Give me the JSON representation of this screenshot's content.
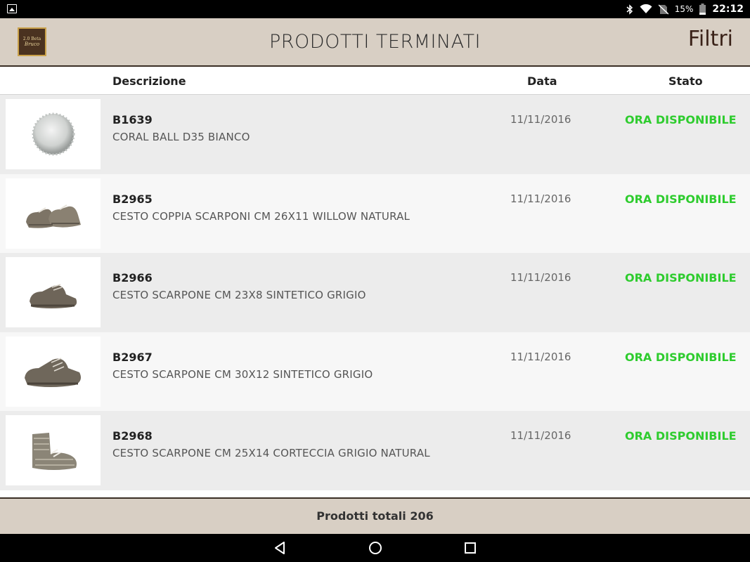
{
  "status_bar": {
    "battery": "15%",
    "time": "22:12",
    "icons": [
      "image-icon",
      "bluetooth-icon",
      "wifi-icon",
      "no-sim-icon",
      "battery-icon"
    ]
  },
  "header": {
    "title": "PRODOTTI TERMINATI",
    "filters_label": "Filtri",
    "logo_line1": "2.0 Beta",
    "logo_line2": "Bruco"
  },
  "columns": {
    "description": "Descrizione",
    "date": "Data",
    "status": "Stato"
  },
  "products": [
    {
      "code": "B1639",
      "description": "CORAL BALL D35 BIANCO",
      "date": "11/11/2016",
      "status": "ORA DISPONIBILE",
      "thumb": "coral-ball"
    },
    {
      "code": "B2965",
      "description": "CESTO COPPIA SCARPONI CM 26X11 WILLOW NATURAL",
      "date": "11/11/2016",
      "status": "ORA DISPONIBILE",
      "thumb": "shoe-pair"
    },
    {
      "code": "B2966",
      "description": "CESTO SCARPONE CM 23X8 SINTETICO GRIGIO",
      "date": "11/11/2016",
      "status": "ORA DISPONIBILE",
      "thumb": "shoe"
    },
    {
      "code": "B2967",
      "description": "CESTO SCARPONE CM 30X12 SINTETICO GRIGIO",
      "date": "11/11/2016",
      "status": "ORA DISPONIBILE",
      "thumb": "shoe"
    },
    {
      "code": "B2968",
      "description": "CESTO SCARPONE CM 25X14 CORTECCIA GRIGIO NATURAL",
      "date": "11/11/2016",
      "status": "ORA DISPONIBILE",
      "thumb": "shoe-open"
    }
  ],
  "footer": {
    "total": "Prodotti totali 206"
  },
  "colors": {
    "header_bg": "#d8cfc4",
    "status_available": "#2ecc2e",
    "row_odd": "#ececec",
    "row_even": "#f7f7f7"
  },
  "nav": {
    "icons": [
      "back-icon",
      "home-icon",
      "recents-icon"
    ]
  }
}
